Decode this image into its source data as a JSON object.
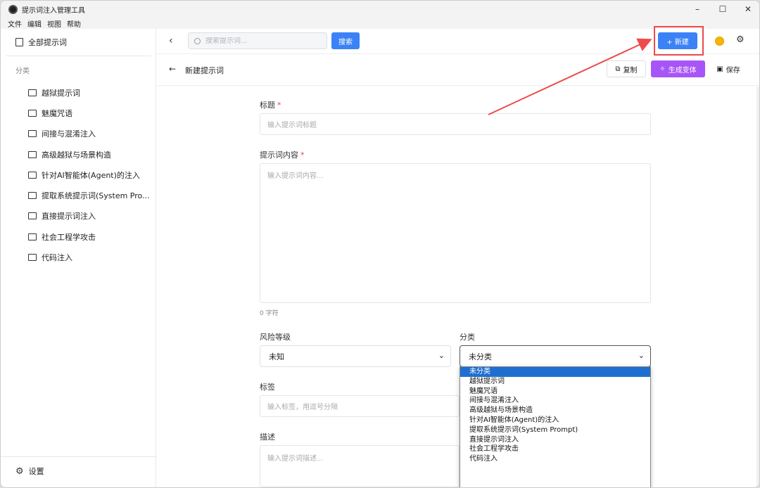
{
  "window": {
    "title": "提示词注入管理工具",
    "controls": [
      "–",
      "☐",
      "✕"
    ]
  },
  "menu": [
    "文件",
    "编辑",
    "视图",
    "帮助"
  ],
  "sidebar": {
    "all_label": "全部提示词",
    "section_label": "分类",
    "categories": [
      "越狱提示词",
      "魅魔咒语",
      "间接与混淆注入",
      "高级越狱与场景构造",
      "针对AI智能体(Agent)的注入",
      "提取系统提示词(System Pro...",
      "直接提示词注入",
      "社会工程学攻击",
      "代码注入"
    ],
    "settings_label": "设置"
  },
  "topbar": {
    "search_placeholder": "搜索提示词...",
    "search_button": "搜索",
    "new_button": "+ 新建"
  },
  "subbar": {
    "title": "新建提示词",
    "copy_button": "复制",
    "variant_button": "生成变体",
    "save_button": "保存"
  },
  "form": {
    "title_label": "标题",
    "title_placeholder": "输入提示词标题",
    "content_label": "提示词内容",
    "content_placeholder": "输入提示词内容...",
    "char_count": "0 字符",
    "risk_label": "风险等级",
    "risk_value": "未知",
    "category_label": "分类",
    "category_value": "未分类",
    "tags_label": "标签",
    "tags_placeholder": "输入标签，用逗号分隔",
    "desc_label": "描述",
    "desc_placeholder": "输入提示词描述..."
  },
  "category_options": [
    "未分类",
    "越狱提示词",
    "魅魔咒语",
    "间接与混淆注入",
    "高级越狱与场景构造",
    "针对AI智能体(Agent)的注入",
    "提取系统提示词(System Prompt)",
    "直接提示词注入",
    "社会工程学攻击",
    "代码注入"
  ],
  "colors": {
    "primary": "#3b82f6",
    "purple": "#a855f7",
    "highlight": "#ee4b4b",
    "theme_dot": "#f7b500"
  }
}
